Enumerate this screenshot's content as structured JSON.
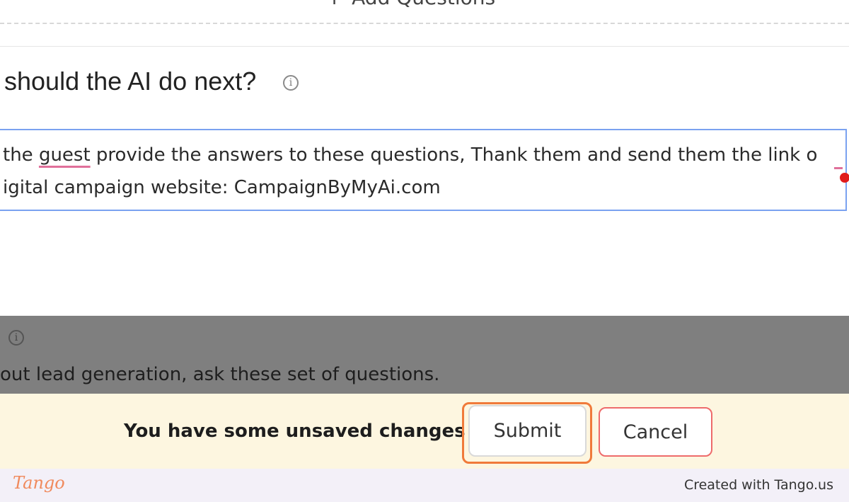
{
  "top": {
    "add_questions_icon": "plus-icon",
    "add_questions_label": "Add Questions"
  },
  "section": {
    "heading": "should the AI do next?",
    "info_icon": "info-icon"
  },
  "textarea": {
    "line1_pre": "the ",
    "line1_misspelled": "guest",
    "line1_post": " provide the answers to these questions, Thank them and send them the link o",
    "line2": "igital campaign website: CampaignByMyAi.com"
  },
  "overlay": {
    "hint": "out lead generation, ask these set of questions."
  },
  "unsaved": {
    "message": "You have some unsaved changes",
    "submit_label": "Submit",
    "cancel_label": "Cancel"
  },
  "footer": {
    "logo": "Tango",
    "created_with": "Created with Tango.us"
  },
  "colors": {
    "highlight_ring": "#f07a3a",
    "cancel_border": "#ee6b6b",
    "textarea_focus": "#7aa2f0",
    "unsaved_bar_bg": "#fdf6e0",
    "footer_bg": "#f3f0f8"
  }
}
